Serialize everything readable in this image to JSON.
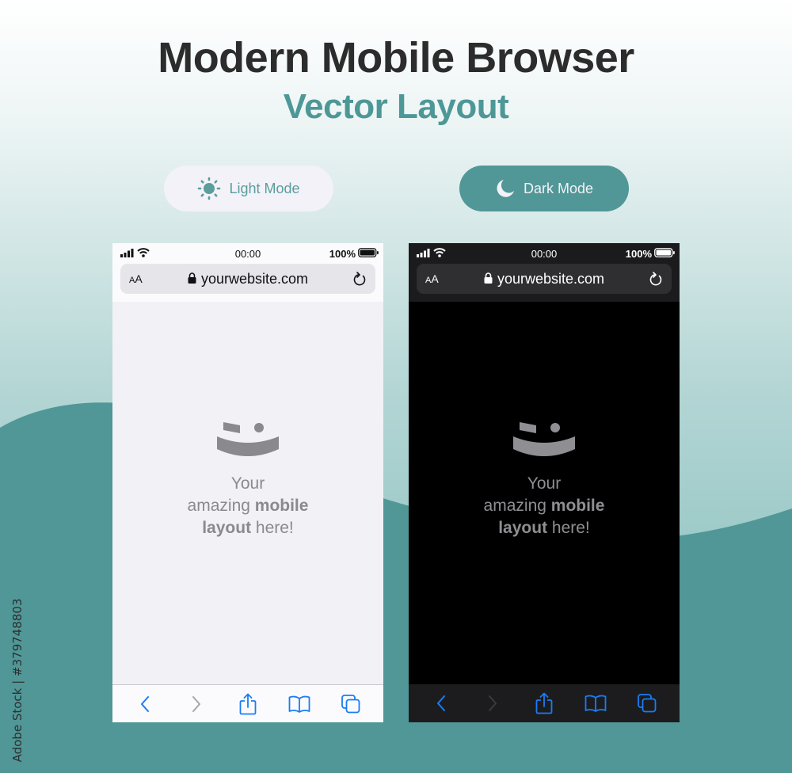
{
  "header": {
    "title": "Modern Mobile Browser",
    "subtitle": "Vector Layout"
  },
  "modes": [
    {
      "label": "Light Mode",
      "icon": "sun-icon",
      "active": false
    },
    {
      "label": "Dark Mode",
      "icon": "moon-icon",
      "active": true
    }
  ],
  "colors": {
    "accent": "#519797",
    "title": "#2c2c2c",
    "link_blue": "#1a7cf5",
    "light_bg": "#f2f1f6",
    "dark_bg": "#000000"
  },
  "phones": {
    "light": {
      "status": {
        "time": "00:00",
        "battery": "100%"
      },
      "urlbar": {
        "text_size_small": "A",
        "text_size_large": "A",
        "url": "yourwebsite.com"
      },
      "message": {
        "line1": "Your",
        "line2_regular": "amazing ",
        "line2_bold": "mobile",
        "line3_bold": "layout",
        "line3_regular": " here!"
      },
      "toolbar": [
        "back-icon",
        "forward-icon",
        "share-icon",
        "bookmarks-icon",
        "tabs-icon"
      ]
    },
    "dark": {
      "status": {
        "time": "00:00",
        "battery": "100%"
      },
      "urlbar": {
        "text_size_small": "A",
        "text_size_large": "A",
        "url": "yourwebsite.com"
      },
      "message": {
        "line1": "Your",
        "line2_regular": "amazing ",
        "line2_bold": "mobile",
        "line3_bold": "layout",
        "line3_regular": " here!"
      },
      "toolbar": [
        "back-icon",
        "forward-icon",
        "share-icon",
        "bookmarks-icon",
        "tabs-icon"
      ]
    }
  },
  "credit": "Adobe Stock | #379748803"
}
